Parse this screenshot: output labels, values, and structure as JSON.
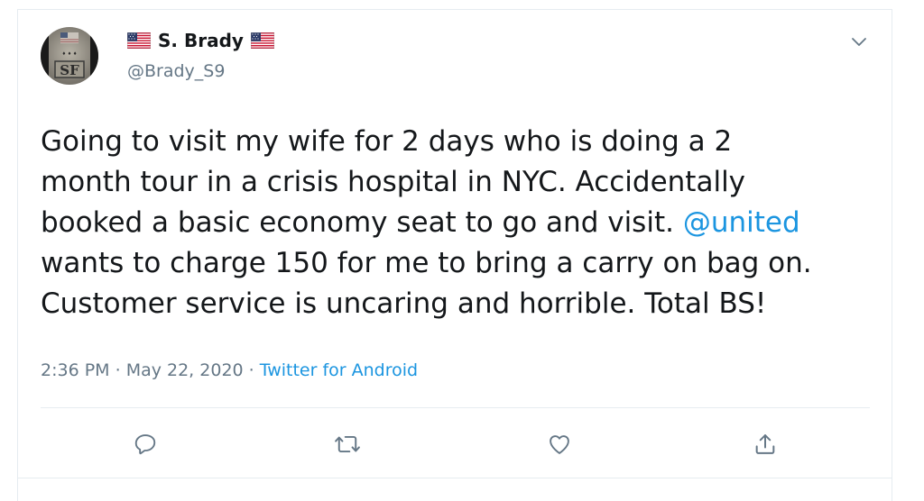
{
  "author": {
    "name": "S. Brady",
    "handle": "@Brady_S9",
    "avatar_text": "SF",
    "flag_emoji": "us-flag"
  },
  "tweet": {
    "lines": [
      "Going to visit my wife for 2 days who is doing a 2",
      "month tour in a crisis hospital in NYC. Accidentally",
      "booked a basic economy seat to go and visit. ",
      "wants to charge 150 for me to bring a carry on bag on.",
      "Customer service is uncaring and horrible. Total BS!"
    ],
    "mention": "@united"
  },
  "meta": {
    "time": "2:36 PM",
    "separator1": " · ",
    "date": "May 22, 2020",
    "separator2": " · ",
    "source": "Twitter for Android"
  },
  "actions": {
    "icons": [
      "reply-icon",
      "retweet-icon",
      "like-icon",
      "share-icon"
    ]
  },
  "colors": {
    "text": "#14171a",
    "secondary": "#657786",
    "link": "#1b95e0",
    "border": "#e6ecf0"
  }
}
